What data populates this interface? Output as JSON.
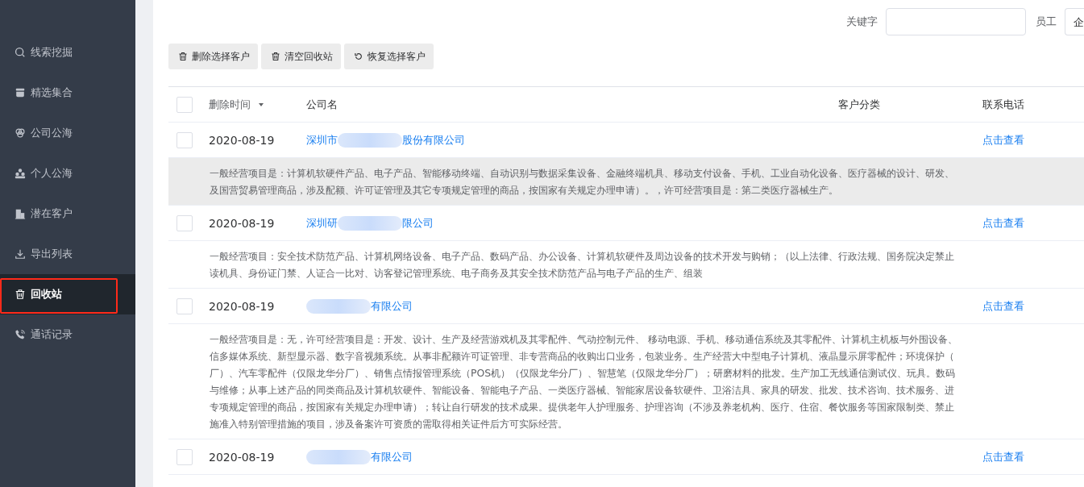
{
  "sidebar": {
    "items": [
      {
        "label": "线索挖掘",
        "selected": false
      },
      {
        "label": "精选集合",
        "selected": false
      },
      {
        "label": "公司公海",
        "selected": false
      },
      {
        "label": "个人公海",
        "selected": false
      },
      {
        "label": "潜在客户",
        "selected": false
      },
      {
        "label": "导出列表",
        "selected": false
      },
      {
        "label": "回收站",
        "selected": true
      },
      {
        "label": "通话记录",
        "selected": false
      }
    ]
  },
  "filters": {
    "keyword": {
      "label": "关键字"
    },
    "employee": {
      "label": "员工",
      "value": "企"
    }
  },
  "actions": [
    {
      "label": "删除选择客户"
    },
    {
      "label": "清空回收站"
    },
    {
      "label": "恢复选择客户"
    }
  ],
  "table": {
    "select_all": {
      "checked": false
    },
    "columns": [
      {
        "label": "删除时间",
        "sortable": true
      },
      {
        "label": "公司名",
        "sortable": false
      },
      {
        "label": "客户分类",
        "sortable": false
      },
      {
        "label": "联系电话",
        "sortable": false
      }
    ],
    "rows": [
      {
        "checked": false,
        "date": "2020-08-19",
        "name_start": "深圳市",
        "name_end": "股份有限公司",
        "phone": "点击查看",
        "hovered": true,
        "description": [
          "一般经营项目是：计算机软硬件产品、电子产品、智能移动终端、自动识别与数据采集设备、金融终端机具、移动支付设备、手机、工业自动化设备、医疗器械的设计、研发、",
          "及国营贸易管理商品，涉及配额、许可证管理及其它专项规定管理的商品，按国家有关规定办理申请）。，许可经营项目是：第二类医疗器械生产。"
        ]
      },
      {
        "checked": false,
        "date": "2020-08-19",
        "name_start": "深圳研",
        "name_end": "限公司",
        "phone": "点击查看",
        "hovered": false,
        "description": [
          "一般经营项目：安全技术防范产品、计算机网络设备、电子产品、数码产品、办公设备、计算机软硬件及周边设备的技术开发与购销；（以上法律、行政法规、国务院决定禁止",
          "读机具、身份证门禁、人证合一比对、访客登记管理系统、电子商务及其安全技术防范产品与电子产品的生产、组装"
        ]
      },
      {
        "checked": false,
        "date": "2020-08-19",
        "name_start": "",
        "name_end": "有限公司",
        "phone": "点击查看",
        "hovered": false,
        "description": [
          "一般经营项目是：无，许可经营项目是：开发、设计、生产及经营游戏机及其零配件、气动控制元件、 移动电源、手机、移动通信系统及其零配件、计算机主机板与外围设备、",
          "信多媒体系统、新型显示器、数字音视频系统。从事非配额许可证管理、非专营商品的收购出口业务，包装业务。生产经营大中型电子计算机、液晶显示屏零配件；环境保护（",
          "厂）、汽车零配件（仅限龙华分厂）、销售点情报管理系统（POS机）（仅限龙华分厂）、智慧笔（仅限龙华分厂）；研磨材料的批发。生产加工无线通信测试仪、玩具。数码",
          "与维修；从事上述产品的同类商品及计算机软硬件、智能设备、智能电子产品、一类医疗器械、智能家居设备软硬件、卫浴洁具、家具的研发、批发、技术咨询、技术服务、进",
          "专项规定管理的商品，按国家有关规定办理申请）；转让自行研发的技术成果。提供老年人护理服务、护理咨询（不涉及养老机构、医疗、住宿、餐饮服务等国家限制类、禁止",
          "施准入特别管理措施的项目，涉及备案许可资质的需取得相关证件后方可实际经营。"
        ]
      },
      {
        "checked": false,
        "date": "2020-08-19",
        "name_start": "",
        "name_end": "有限公司",
        "phone": "点击查看"
      }
    ]
  }
}
